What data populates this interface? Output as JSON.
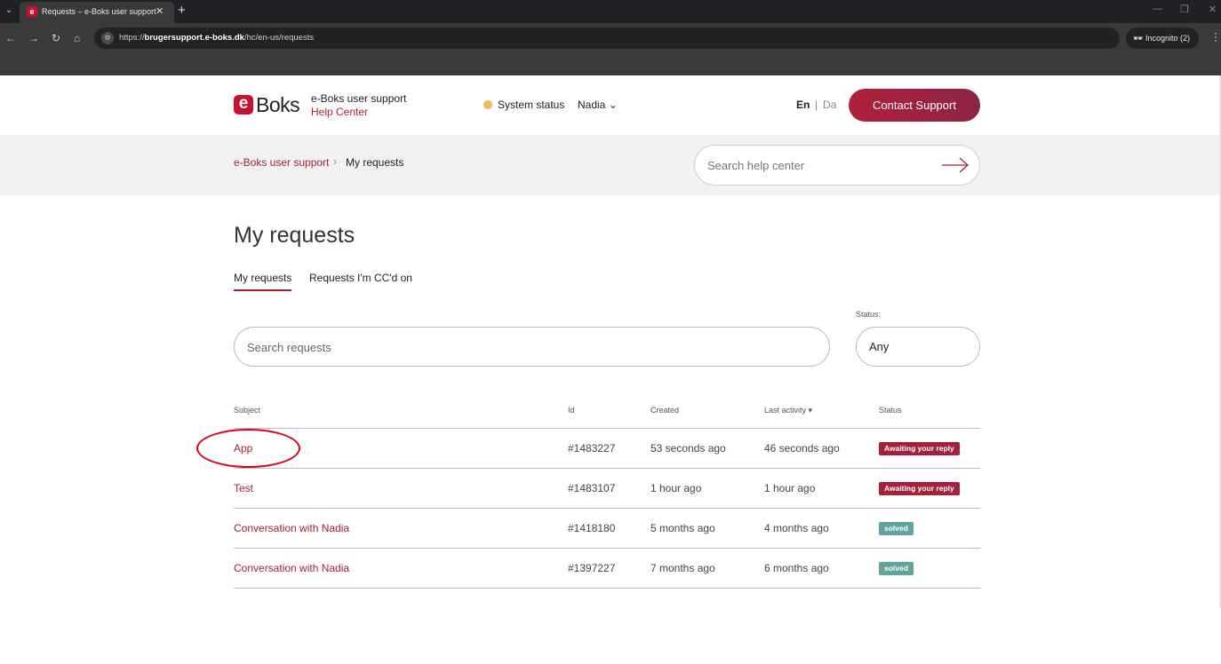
{
  "browser": {
    "tab_title": "Requests – e-Boks user support",
    "favicon_letter": "e",
    "url_prefix": "https://",
    "url_host": "brugersupport.e-boks.dk",
    "url_path": "/hc/en-us/requests",
    "incognito_label": "Incognito (2)"
  },
  "header": {
    "logo_letter": "e",
    "logo_word": "Boks",
    "brand_title": "e-Boks user support",
    "brand_subtitle": "Help Center",
    "system_status": "System status",
    "user_name": "Nadia ⌄",
    "lang_en": "En",
    "lang_sep": "|",
    "lang_da": "Da",
    "contact_button": "Contact Support",
    "status_color": "#f0b95a",
    "accent_color": "#a3213a"
  },
  "breadcrumb": {
    "root": "e-Boks user support",
    "separator": "›",
    "current": "My requests"
  },
  "help_search": {
    "placeholder": "Search help center"
  },
  "main": {
    "title": "My requests",
    "tabs": [
      {
        "label": "My requests",
        "active": true
      },
      {
        "label": "Requests I'm CC'd on",
        "active": false
      }
    ],
    "search_placeholder": "Search requests",
    "status_label": "Status:",
    "status_value": "Any"
  },
  "table": {
    "headers": {
      "subject": "Subject",
      "id": "Id",
      "created": "Created",
      "last_activity": "Last activity ▾",
      "status": "Status"
    },
    "rows": [
      {
        "subject": "App",
        "id": "#1483227",
        "created": "53 seconds ago",
        "last_activity": "46 seconds ago",
        "status": "Awaiting your reply",
        "status_type": "awaiting"
      },
      {
        "subject": "Test",
        "id": "#1483107",
        "created": "1 hour ago",
        "last_activity": "1 hour ago",
        "status": "Awaiting your reply",
        "status_type": "awaiting"
      },
      {
        "subject": "Conversation with Nadia",
        "id": "#1418180",
        "created": "5 months ago",
        "last_activity": "4 months ago",
        "status": "solved",
        "status_type": "solved"
      },
      {
        "subject": "Conversation with Nadia",
        "id": "#1397227",
        "created": "7 months ago",
        "last_activity": "6 months ago",
        "status": "solved",
        "status_type": "solved"
      }
    ]
  }
}
